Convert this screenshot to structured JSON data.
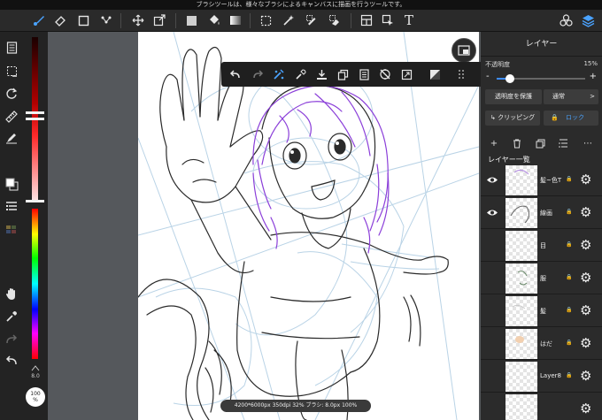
{
  "tip_bar": {
    "text": "ブラシツールは、様々なブラシによるキャンバスに描画を行うツールです。"
  },
  "toolbar": {
    "icons": [
      "brush-icon",
      "eraser-icon",
      "rectangle-icon",
      "dot-brush-icon",
      "move-icon",
      "transform-icon",
      "fill-color-icon",
      "bucket-icon",
      "gradient-icon",
      "select-rect-icon",
      "magic-wand-icon",
      "select-pen-icon",
      "select-eraser-icon",
      "frame-divider-icon",
      "select-point-icon",
      "text-icon",
      "materials-icon",
      "layers-icon"
    ],
    "text_tool_glyph": "T"
  },
  "left_tools": [
    "menu-icon",
    "selection-icon",
    "rotate-icon",
    "ruler-icon",
    "pen-icon",
    "color-swatch-icon",
    "layer-list-icon",
    "palette-icon",
    "hand-icon",
    "eyedropper-icon",
    "redo-icon",
    "undo-icon"
  ],
  "color_panel": {
    "brush_size_label": "8.0",
    "zoom_label": "100\n%"
  },
  "float_bar": {
    "icons": [
      "undo-icon",
      "redo-icon",
      "stabilizer-icon",
      "eyedropper-icon",
      "save-icon",
      "copy-icon",
      "paste-icon",
      "snap-off-icon",
      "fullscreen-icon",
      "layer-effect-icon",
      "more-dots-icon"
    ]
  },
  "status": {
    "text": "4200*6000px 350dpi 32% ブラシ: 8.0px 100%"
  },
  "layer_panel": {
    "title": "レイヤー",
    "opacity_label": "不透明度",
    "opacity_value": "15%",
    "opacity_fraction": 0.15,
    "minus": "-",
    "plus": "+",
    "protect_alpha": "透明度を保護",
    "blend_mode": "通常",
    "blend_arrow": ">",
    "clipping": "クリッピング",
    "lock": "ロック",
    "list_title": "レイヤー一覧",
    "accent_color": "#3d8dff",
    "layers": [
      {
        "name": "髪~色T",
        "visible": true
      },
      {
        "name": "線画",
        "visible": true
      },
      {
        "name": "目",
        "visible": false
      },
      {
        "name": "服",
        "visible": false
      },
      {
        "name": "髪",
        "visible": false
      },
      {
        "name": "はだ",
        "visible": false
      },
      {
        "name": "Layer8",
        "visible": false
      }
    ]
  }
}
